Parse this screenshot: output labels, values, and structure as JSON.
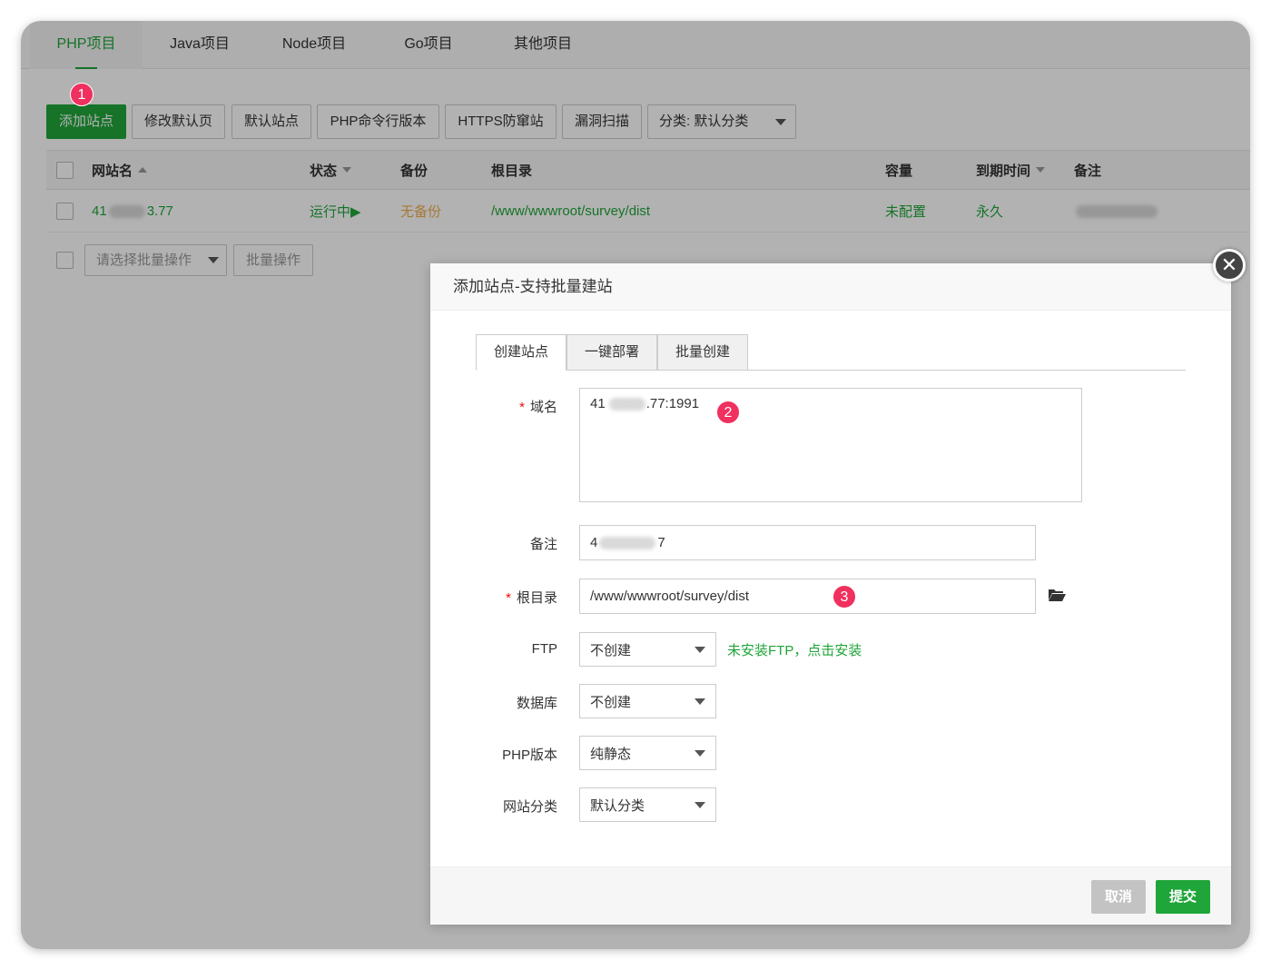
{
  "topnav": {
    "tabs": [
      {
        "label": "PHP项目",
        "active": true
      },
      {
        "label": "Java项目"
      },
      {
        "label": "Node项目"
      },
      {
        "label": "Go项目"
      },
      {
        "label": "其他项目"
      }
    ]
  },
  "toolbar": {
    "add_site": "添加站点",
    "edit_default_page": "修改默认页",
    "default_site": "默认站点",
    "php_cli": "PHP命令行版本",
    "https_guard": "HTTPS防窜站",
    "vuln_scan": "漏洞扫描",
    "category": "分类: 默认分类"
  },
  "table": {
    "columns": [
      "网站名",
      "状态",
      "备份",
      "根目录",
      "容量",
      "到期时间",
      "备注"
    ],
    "rows": [
      {
        "name_prefix": "41",
        "name_suffix": "3.77",
        "status": "运行中▶",
        "backup": "无备份",
        "root": "/www/wwwroot/survey/dist",
        "capacity": "未配置",
        "expire": "永久"
      }
    ],
    "batch_placeholder": "请选择批量操作",
    "batch_button": "批量操作"
  },
  "annotations": {
    "step1": "1",
    "step2": "2",
    "step3": "3"
  },
  "dialog": {
    "title": "添加站点-支持批量建站",
    "close_glyph": "✕",
    "tabs": [
      "创建站点",
      "一键部署",
      "批量创建"
    ],
    "fields": {
      "domain_label": "域名",
      "domain_prefix": "41",
      "domain_suffix": ".77:1991",
      "remark_label": "备注",
      "remark_prefix": "4",
      "remark_suffix": "7",
      "root_label": "根目录",
      "root_value": "/www/wwwroot/survey/dist",
      "ftp_label": "FTP",
      "ftp_value": "不创建",
      "ftp_hint": "未安装FTP，点击安装",
      "db_label": "数据库",
      "db_value": "不创建",
      "php_label": "PHP版本",
      "php_value": "纯静态",
      "category_label": "网站分类",
      "category_value": "默认分类"
    },
    "cancel": "取消",
    "submit": "提交"
  },
  "colors": {
    "accent": "#20a53a",
    "badge": "#f0305e",
    "warning": "#f0ad4e"
  }
}
